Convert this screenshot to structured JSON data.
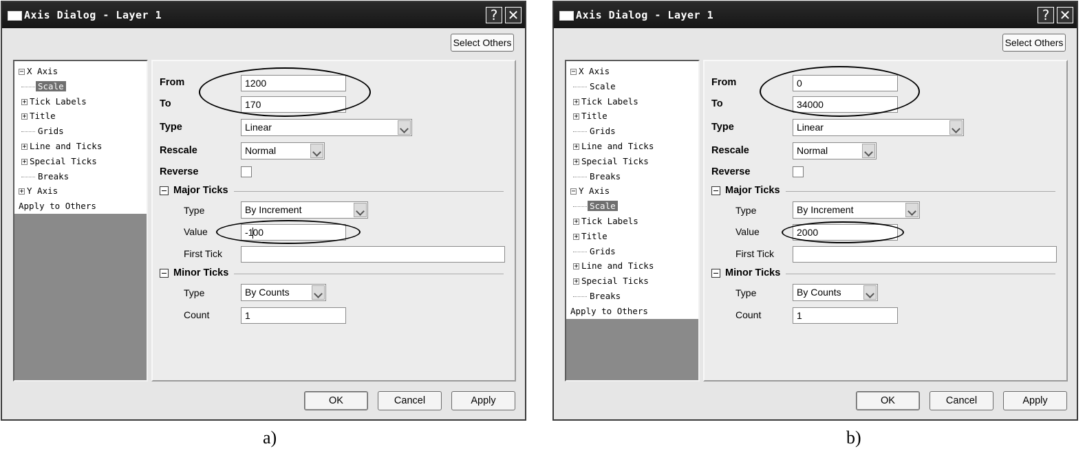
{
  "captions": {
    "a": "a)",
    "b": "b)"
  },
  "icons": {
    "help": "question-mark",
    "close": "x-mark",
    "expand": "plus-box",
    "collapse": "minus-box"
  },
  "dialog_a": {
    "title": "Axis Dialog - Layer 1",
    "help_glyph": "?",
    "close_glyph": "✕",
    "select_others": "Select Others",
    "tree": [
      {
        "label": "X Axis",
        "state": "collapse"
      },
      {
        "label": "Scale",
        "selected": true
      },
      {
        "label": "Tick Labels",
        "state": "expand"
      },
      {
        "label": "Title",
        "state": "expand"
      },
      {
        "label": "Grids"
      },
      {
        "label": "Line and Ticks",
        "state": "expand"
      },
      {
        "label": "Special Ticks",
        "state": "expand"
      },
      {
        "label": "Breaks"
      },
      {
        "label": "Y Axis",
        "state": "expand"
      },
      {
        "label": "Apply to Others"
      }
    ],
    "from_label": "From",
    "from_value": "1200",
    "to_label": "To",
    "to_value": "170",
    "type_label": "Type",
    "type_value": "Linear",
    "rescale_label": "Rescale",
    "rescale_value": "Normal",
    "reverse_label": "Reverse",
    "reverse_checked": false,
    "major_label": "Major Ticks",
    "major_type_label": "Type",
    "major_type_value": "By Increment",
    "value_label": "Value",
    "value_pre": "-1",
    "value_post": "00",
    "first_tick_label": "First Tick",
    "first_tick_value": "",
    "minor_label": "Minor Ticks",
    "minor_type_label": "Type",
    "minor_type_value": "By Counts",
    "count_label": "Count",
    "count_value": "1",
    "ok": "OK",
    "cancel": "Cancel",
    "apply": "Apply"
  },
  "dialog_b": {
    "title": "Axis Dialog - Layer 1",
    "help_glyph": "?",
    "close_glyph": "✕",
    "select_others": "Select Others",
    "tree": [
      {
        "label": "X Axis",
        "state": "collapse"
      },
      {
        "label": "Scale"
      },
      {
        "label": "Tick Labels",
        "state": "expand"
      },
      {
        "label": "Title",
        "state": "expand"
      },
      {
        "label": "Grids"
      },
      {
        "label": "Line and Ticks",
        "state": "expand"
      },
      {
        "label": "Special Ticks",
        "state": "expand"
      },
      {
        "label": "Breaks"
      },
      {
        "label": "Y Axis",
        "state": "collapse"
      },
      {
        "label": "Scale",
        "selected": true
      },
      {
        "label": "Tick Labels",
        "state": "expand"
      },
      {
        "label": "Title",
        "state": "expand"
      },
      {
        "label": "Grids"
      },
      {
        "label": "Line and Ticks",
        "state": "expand"
      },
      {
        "label": "Special Ticks",
        "state": "expand"
      },
      {
        "label": "Breaks"
      },
      {
        "label": "Apply to Others"
      }
    ],
    "from_label": "From",
    "from_value": "0",
    "to_label": "To",
    "to_value": "34000",
    "type_label": "Type",
    "type_value": "Linear",
    "rescale_label": "Rescale",
    "rescale_value": "Normal",
    "reverse_label": "Reverse",
    "reverse_checked": false,
    "major_label": "Major Ticks",
    "major_type_label": "Type",
    "major_type_value": "By Increment",
    "value_label": "Value",
    "value_pre": "2000",
    "value_post": "",
    "first_tick_label": "First Tick",
    "first_tick_value": "",
    "minor_label": "Minor Ticks",
    "minor_type_label": "Type",
    "minor_type_value": "By Counts",
    "count_label": "Count",
    "count_value": "1",
    "ok": "OK",
    "cancel": "Cancel",
    "apply": "Apply"
  }
}
